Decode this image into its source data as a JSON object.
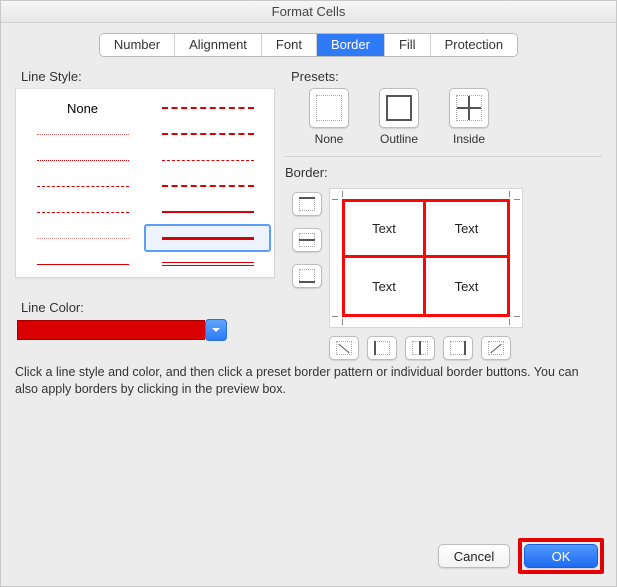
{
  "window": {
    "title": "Format Cells"
  },
  "tabs": {
    "items": [
      "Number",
      "Alignment",
      "Font",
      "Border",
      "Fill",
      "Protection"
    ],
    "active_index": 3
  },
  "left": {
    "style_label": "Line Style:",
    "none_label": "None",
    "color_label": "Line Color:",
    "color_value": "#d80000"
  },
  "right": {
    "presets_label": "Presets:",
    "presets": {
      "none": "None",
      "outline": "Outline",
      "inside": "Inside"
    },
    "border_label": "Border:",
    "preview_text": "Text"
  },
  "instructions": "Click a line style and color, and then click a preset border pattern or individual border buttons. You can also apply borders by clicking in the preview box.",
  "footer": {
    "cancel": "Cancel",
    "ok": "OK"
  }
}
